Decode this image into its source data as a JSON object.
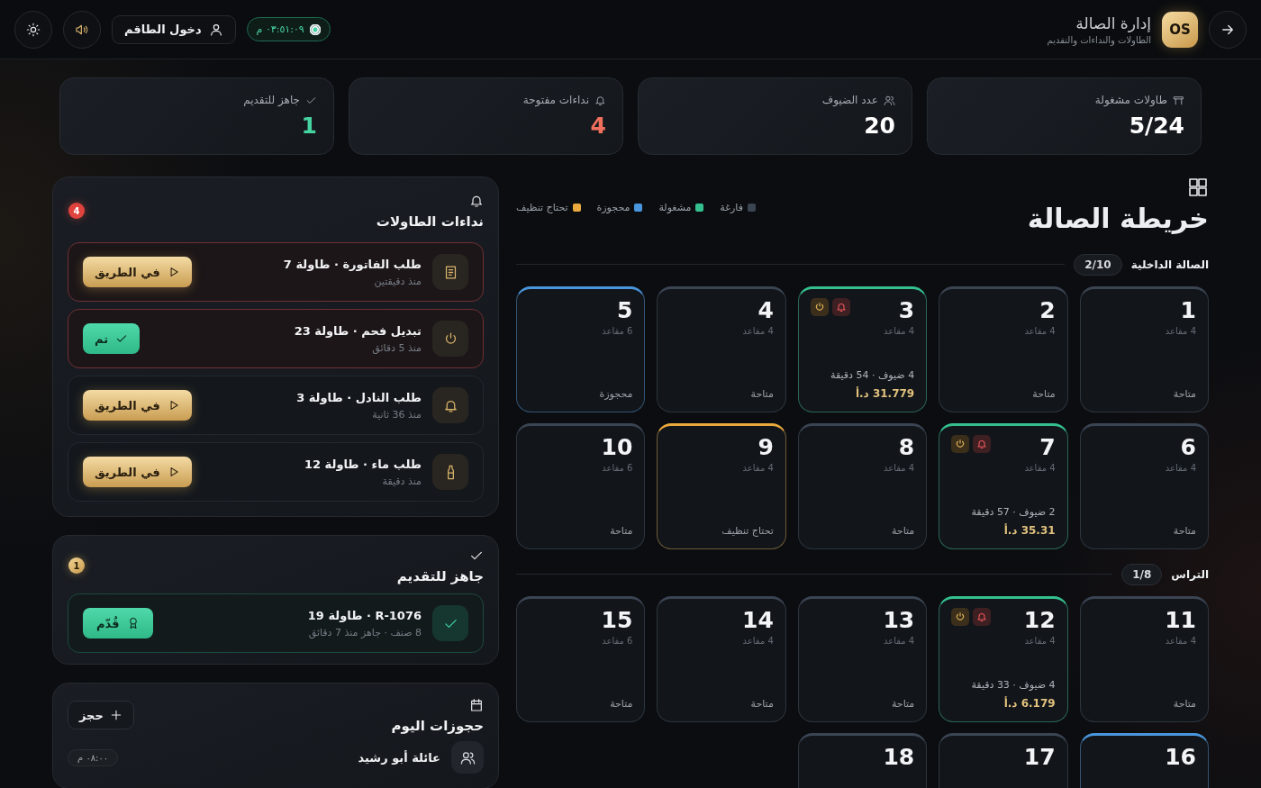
{
  "header": {
    "title": "إدارة الصالة",
    "subtitle": "الطاولات والنداءات والتقديم",
    "logo": "OS",
    "clock": "٠٣:٥١:٠٩ م",
    "staff_button": "دخول الطاقم"
  },
  "stats": [
    {
      "kind": "tables",
      "label": "طاولات مشغولة",
      "value": "5/24",
      "color": "#ffffff"
    },
    {
      "kind": "guests",
      "label": "عدد الضيوف",
      "value": "20",
      "color": "#ffffff"
    },
    {
      "kind": "calls",
      "label": "نداءات مفتوحة",
      "value": "4",
      "color": "#f0705e"
    },
    {
      "kind": "ready",
      "label": "جاهز للتقديم",
      "value": "1",
      "color": "#45d3a2"
    }
  ],
  "floor_map": {
    "title": "خريطة الصالة",
    "legend": [
      {
        "kind": "free",
        "label": "فارغة",
        "color": "#3b4452"
      },
      {
        "kind": "occupied",
        "label": "مشغولة",
        "color": "#34c08e"
      },
      {
        "kind": "reserved",
        "label": "محجوزة",
        "color": "#4a96dc"
      },
      {
        "kind": "cleaning",
        "label": "تحتاج تنظيف",
        "color": "#e9a93c"
      }
    ],
    "sections": [
      {
        "name": "الصالة الداخلية",
        "count": "2/10",
        "tables": [
          {
            "number": "1",
            "seats": "4 مقاعد",
            "kind": "free",
            "status_label": "متاحة"
          },
          {
            "number": "2",
            "seats": "4 مقاعد",
            "kind": "free",
            "status_label": "متاحة"
          },
          {
            "number": "3",
            "seats": "4 مقاعد",
            "kind": "occupied",
            "guests": "4 ضيوف · 54 دقيقة",
            "bill": "31.779 د.أ",
            "badges": [
              {
                "kind": "call"
              },
              {
                "kind": "coal"
              }
            ]
          },
          {
            "number": "4",
            "seats": "4 مقاعد",
            "kind": "free",
            "status_label": "متاحة"
          },
          {
            "number": "5",
            "seats": "6 مقاعد",
            "kind": "reserved",
            "status_label": "محجوزة"
          },
          {
            "number": "6",
            "seats": "4 مقاعد",
            "kind": "free",
            "status_label": "متاحة"
          },
          {
            "number": "7",
            "seats": "4 مقاعد",
            "kind": "occupied",
            "guests": "2 ضيوف · 57 دقيقة",
            "bill": "35.31 د.أ",
            "badges": [
              {
                "kind": "call"
              },
              {
                "kind": "coal"
              }
            ]
          },
          {
            "number": "8",
            "seats": "4 مقاعد",
            "kind": "free",
            "status_label": "متاحة"
          },
          {
            "number": "9",
            "seats": "4 مقاعد",
            "kind": "cleaning",
            "status_label": "تحتاج تنظيف"
          },
          {
            "number": "10",
            "seats": "6 مقاعد",
            "kind": "free",
            "status_label": "متاحة"
          }
        ]
      },
      {
        "name": "التراس",
        "count": "1/8",
        "tables": [
          {
            "number": "11",
            "seats": "4 مقاعد",
            "kind": "free",
            "status_label": "متاحة"
          },
          {
            "number": "12",
            "seats": "4 مقاعد",
            "kind": "occupied",
            "guests": "4 ضيوف · 33 دقيقة",
            "bill": "6.179 د.أ",
            "badges": [
              {
                "kind": "call"
              },
              {
                "kind": "coal"
              }
            ]
          },
          {
            "number": "13",
            "seats": "4 مقاعد",
            "kind": "free",
            "status_label": "متاحة"
          },
          {
            "number": "14",
            "seats": "4 مقاعد",
            "kind": "free",
            "status_label": "متاحة"
          },
          {
            "number": "15",
            "seats": "6 مقاعد",
            "kind": "free",
            "status_label": "متاحة"
          },
          {
            "number": "16",
            "kind": "reserved"
          },
          {
            "number": "17",
            "kind": "free"
          },
          {
            "number": "18",
            "kind": "free"
          }
        ]
      }
    ]
  },
  "calls_panel": {
    "title": "نداءات الطاولات",
    "count": "4",
    "calls": [
      {
        "kind": "bill",
        "title": "طلب الفاتورة · طاولة 7",
        "time": "منذ دقيقتين",
        "urgent": true,
        "action": {
          "kind": "on_way",
          "label": "في الطريق"
        }
      },
      {
        "kind": "coal",
        "title": "تبديل فحم · طاولة 23",
        "time": "منذ 5 دقائق",
        "urgent": true,
        "action": {
          "kind": "done",
          "label": "تم"
        }
      },
      {
        "kind": "waiter",
        "title": "طلب النادل · طاولة 3",
        "time": "منذ 36 ثانية",
        "urgent": false,
        "action": {
          "kind": "on_way",
          "label": "في الطريق"
        }
      },
      {
        "kind": "water",
        "title": "طلب ماء · طاولة 12",
        "time": "منذ دقيقة",
        "urgent": false,
        "action": {
          "kind": "on_way",
          "label": "في الطريق"
        }
      }
    ]
  },
  "ready_panel": {
    "title": "جاهز للتقديم",
    "count": "1",
    "orders": [
      {
        "title": "R-1076 · طاولة 19",
        "detail": "8 صنف · جاهز منذ 7 دقائق",
        "action": "قُدّم"
      }
    ]
  },
  "reservations_panel": {
    "title": "حجوزات اليوم",
    "add_button": "حجز",
    "reservations": [
      {
        "name": "عائلة أبو رشيد",
        "time": "٠٨:٠٠ م"
      }
    ]
  }
}
